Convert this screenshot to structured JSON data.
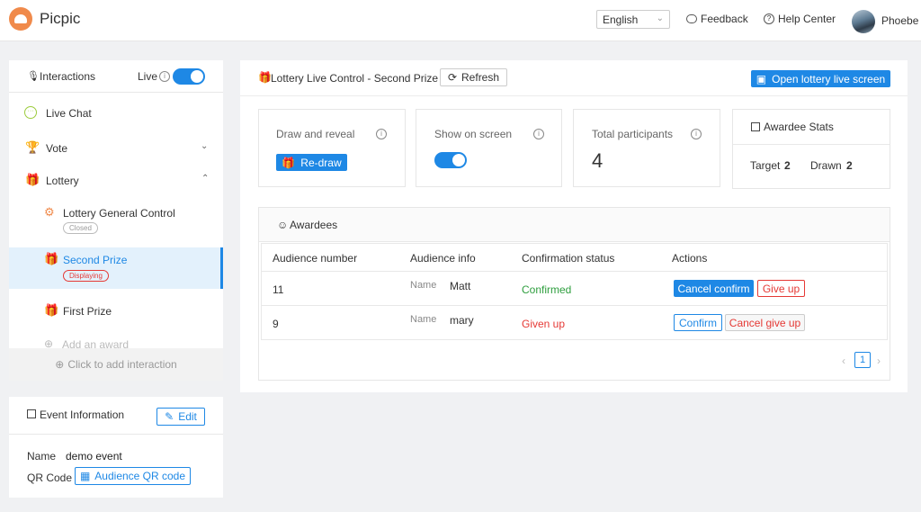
{
  "app": {
    "name": "Picpic"
  },
  "header": {
    "language": "English",
    "feedback": "Feedback",
    "help": "Help Center",
    "user": "Phoebe"
  },
  "sidebar": {
    "title": "Interactions",
    "live_label": "Live",
    "live_on": true,
    "items": {
      "live_chat": "Live Chat",
      "vote": "Vote",
      "lottery": "Lottery",
      "general_control": "Lottery General Control",
      "general_control_tag": "Closed",
      "second_prize": "Second Prize",
      "second_prize_tag": "Displaying",
      "first_prize": "First Prize",
      "add_award": "Add an award"
    },
    "add_interaction": "Click to add interaction"
  },
  "event_info": {
    "title": "Event Information",
    "edit": "Edit",
    "name_label": "Name",
    "name_value": "demo event",
    "qr_label": "QR Code",
    "qr_button": "Audience QR code"
  },
  "main": {
    "title": "Lottery Live Control - Second Prize",
    "refresh": "Refresh",
    "open_screen": "Open lottery live screen",
    "cards": {
      "draw_title": "Draw and reveal",
      "redraw": "Re-draw",
      "show_title": "Show on screen",
      "show_on": true,
      "participants_title": "Total participants",
      "participants_value": "4",
      "stats_title": "Awardee Stats",
      "target_label": "Target",
      "target_value": "2",
      "drawn_label": "Drawn",
      "drawn_value": "2"
    },
    "awardees": {
      "title": "Awardees",
      "columns": [
        "Audience number",
        "Audience info",
        "Confirmation status",
        "Actions"
      ],
      "rows": [
        {
          "number": "11",
          "info_label": "Name",
          "info_value": "Matt",
          "status": "Confirmed",
          "action1": "Cancel confirm",
          "action2": "Give up"
        },
        {
          "number": "9",
          "info_label": "Name",
          "info_value": "mary",
          "status": "Given up",
          "action1": "Confirm",
          "action2": "Cancel give up"
        }
      ],
      "page": "1"
    }
  },
  "colors": {
    "accent": "#1e88e5",
    "brand": "#f08a4b",
    "danger": "#e53935",
    "success": "#2e9e3e"
  }
}
